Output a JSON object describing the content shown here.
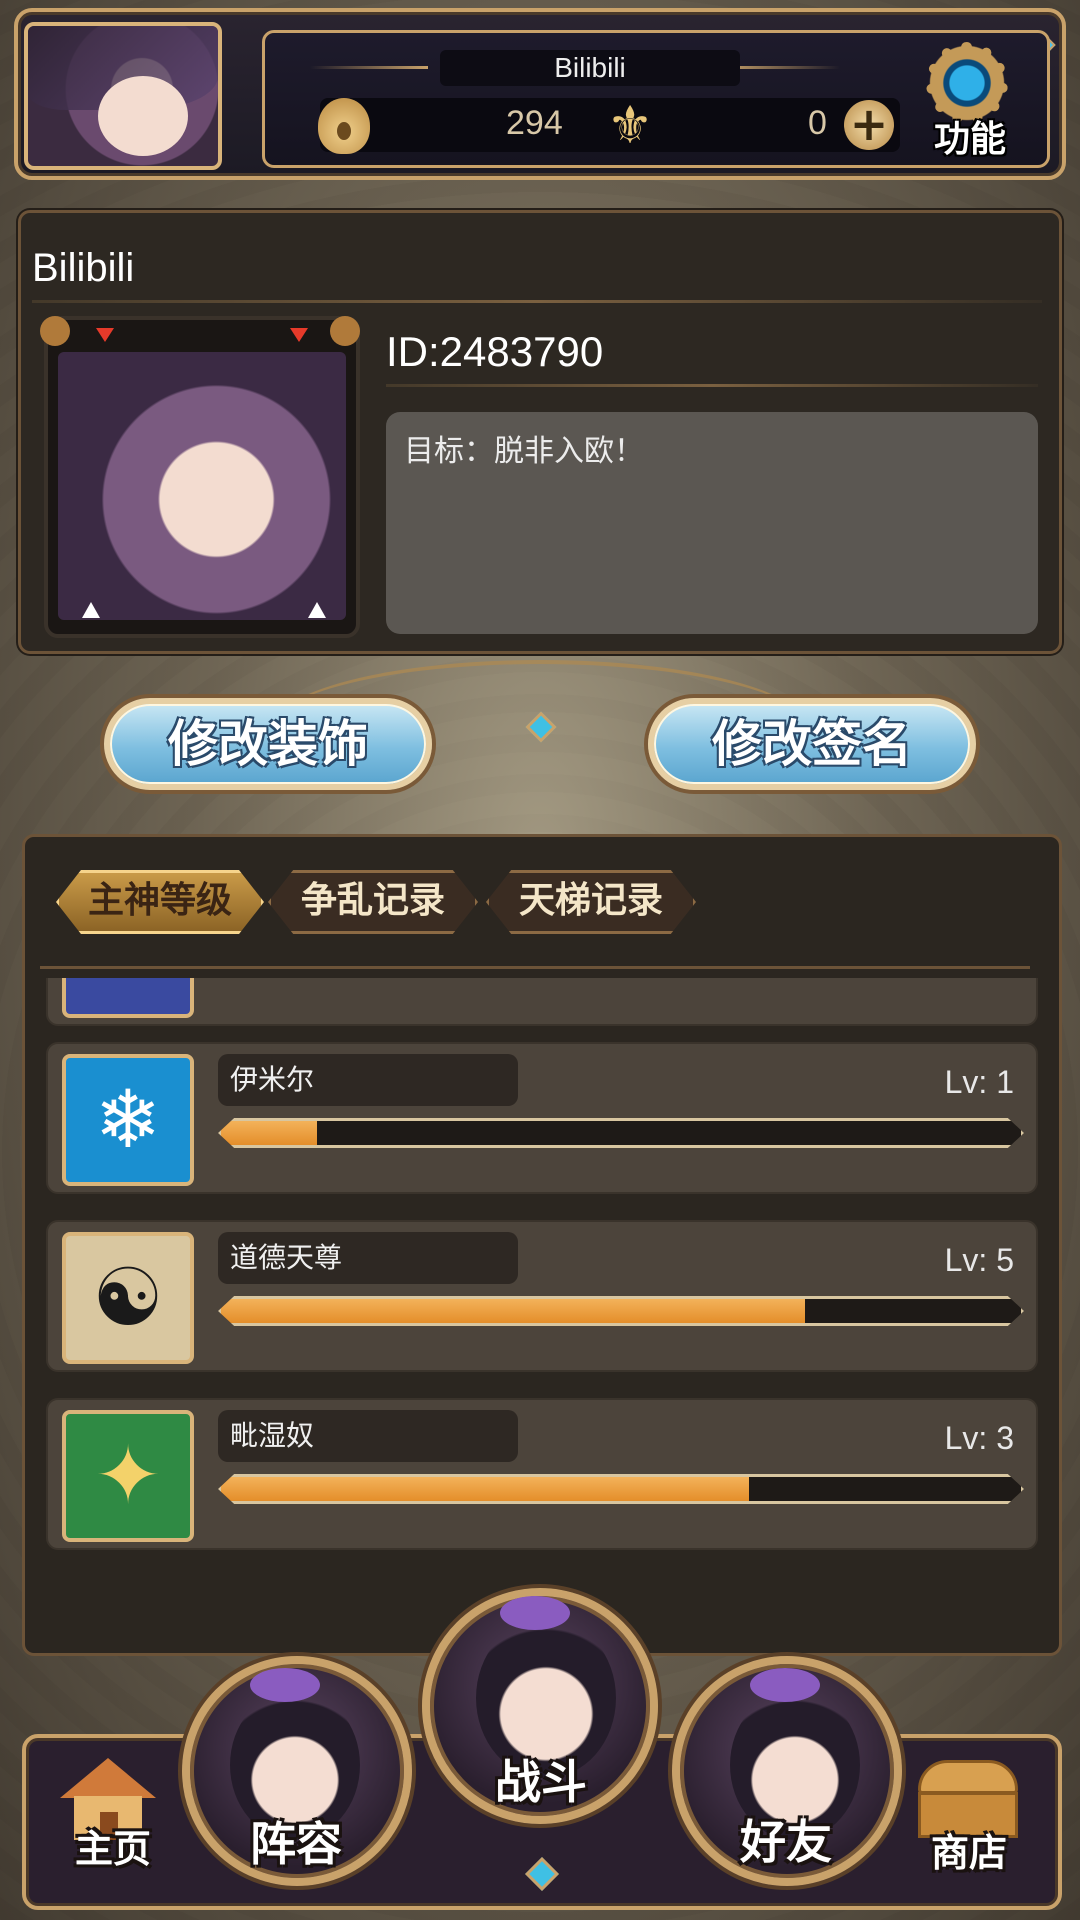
{
  "header": {
    "player_name": "Bilibili",
    "currency": "294",
    "gems": "0",
    "function_label": "功能"
  },
  "profile": {
    "name": "Bilibili",
    "id_text": "ID:2483790",
    "signature": "目标：脱非入欧！"
  },
  "actions": {
    "edit_decoration": "修改装饰",
    "edit_signature": "修改签名"
  },
  "tabs": [
    {
      "label": "主神等级",
      "active": true
    },
    {
      "label": "争乱记录",
      "active": false
    },
    {
      "label": "天梯记录",
      "active": false
    }
  ],
  "deities": [
    {
      "name": "伊米尔",
      "level": "Lv: 1",
      "progress": 0.12,
      "icon": "ice-deity-icon",
      "icon_color": "#1a8fd0",
      "glyph": "❄"
    },
    {
      "name": "道德天尊",
      "level": "Lv: 5",
      "progress": 0.73,
      "icon": "yin-yang-icon",
      "icon_color": "#d9c7a0",
      "glyph": "☯"
    },
    {
      "name": "毗湿奴",
      "level": "Lv: 3",
      "progress": 0.66,
      "icon": "lotus-icon",
      "icon_color": "#2f8a44",
      "glyph": "✦"
    }
  ],
  "nav": {
    "home": "主页",
    "lineup": "阵容",
    "battle": "战斗",
    "friends": "好友",
    "shop": "商店"
  },
  "colors": {
    "accent_gold": "#c9a26a",
    "button_blue": "#7fbfe0",
    "progress_orange": "#e48e2a"
  }
}
